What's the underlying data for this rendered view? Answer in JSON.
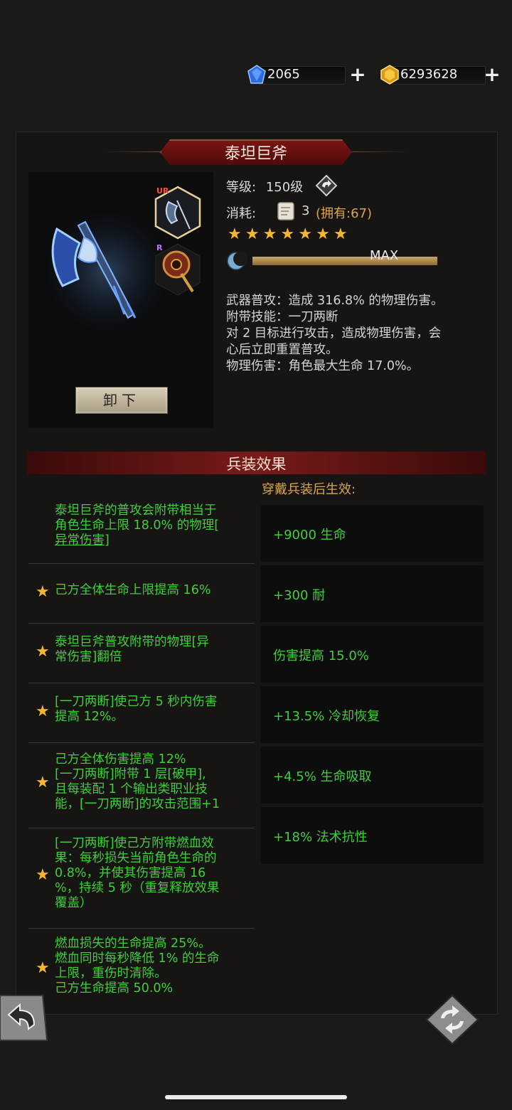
{
  "currencies": [
    {
      "name": "diamond",
      "value": "2065",
      "icon": "blue-gem-icon"
    },
    {
      "name": "gold",
      "value": "6293628",
      "icon": "gold-gem-icon"
    }
  ],
  "weapon": {
    "name": "泰坦巨斧",
    "level_label": "等级:",
    "level_value": "150级",
    "cost_label": "消耗:",
    "cost_value": "3",
    "cost_owned": "(拥有:67)",
    "stars": 7,
    "star_glyph": "★",
    "progress_label": "MAX",
    "progress": 1.0,
    "rarity_ur": "UR",
    "rarity_r": "R",
    "unequip_label": "卸下",
    "description": [
      "武器普攻：造成 316.8% 的物理伤害。",
      "附带技能：一刀两断",
      "对 2 目标进行攻击，造成物理伤害，会",
      "心后立即重置普攻。",
      "物理伤害：角色最大生命 17.0%。"
    ]
  },
  "equipment_effects": {
    "header": "兵装效果",
    "note": "穿戴兵装后生效:",
    "effects": [
      {
        "starred": false,
        "lines": [
          "泰坦巨斧的普攻会附带相当于",
          "角色生命上限 18.0% 的物理[",
          "异常伤害]"
        ]
      },
      {
        "starred": true,
        "lines": [
          "己方全体生命上限提高 16%"
        ]
      },
      {
        "starred": true,
        "lines": [
          "泰坦巨斧普攻附带的物理[异",
          "常伤害]翻倍"
        ]
      },
      {
        "starred": true,
        "lines": [
          "[一刀两断]使己方 5 秒内伤害",
          "提高 12%。"
        ]
      },
      {
        "starred": true,
        "lines": [
          "己方全体伤害提高 12%",
          "[一刀两断]附带 1 层[破甲],",
          "且每装配 1 个输出类职业技",
          "能，[一刀两断]的攻击范围+1"
        ]
      },
      {
        "starred": true,
        "lines": [
          "[一刀两断]使己方附带燃血效",
          "果：每秒损失当前角色生命的",
          "0.8%，并使其伤害提高 16",
          "%，持续 5 秒（重复释放效果",
          "覆盖）"
        ]
      },
      {
        "starred": true,
        "lines": [
          "燃血损失的生命提高 25%。",
          "燃血同时每秒降低 1% 的生命",
          "上限，重伤时清除。",
          "己方生命提高 50.0%"
        ]
      }
    ],
    "stats": [
      "+9000 生命",
      "+300 耐",
      "伤害提高 15.0%",
      "+13.5% 冷却恢复",
      "+4.5% 生命吸取",
      "+18% 法术抗性"
    ]
  },
  "colors": {
    "accent_red": "#7a1414",
    "effect_green": "#3ecf3a",
    "star_gold": "#f5b731",
    "note_orange": "#d9a553"
  }
}
